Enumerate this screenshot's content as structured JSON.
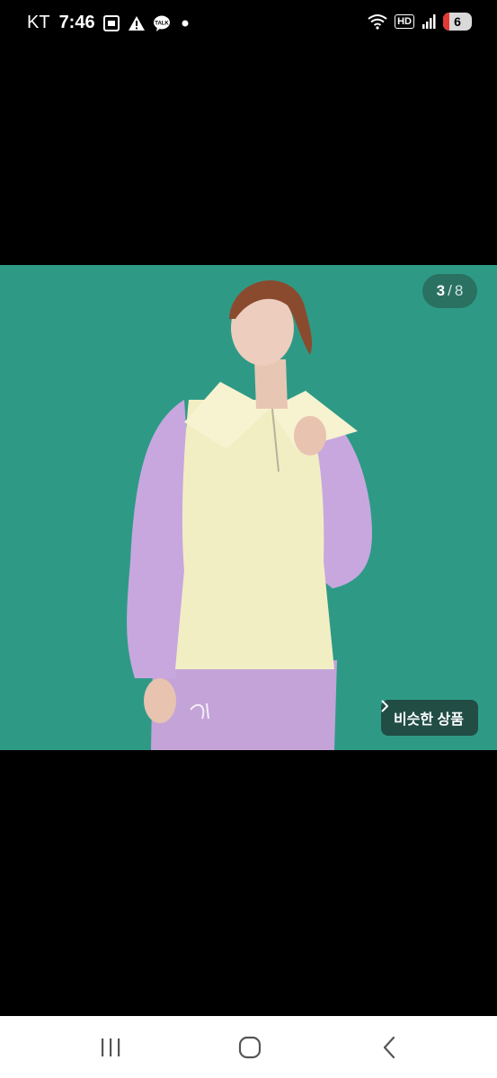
{
  "status_bar": {
    "carrier": "KT",
    "time": "7:46",
    "notification_icons": [
      "screenshot-icon",
      "warning-icon",
      "kakaotalk-icon",
      "dot-icon"
    ],
    "kakao_label": "TALK",
    "hd_label": "HD",
    "battery_level": "6"
  },
  "gallery": {
    "current": "3",
    "separator": "/",
    "total": "8",
    "similar_button_label": "비슷한 상품"
  },
  "nav_bar": {
    "buttons": [
      "recents-icon",
      "home-icon",
      "back-icon"
    ]
  },
  "colors": {
    "background": "#000000",
    "photo_bg": "#2e9a86",
    "sleeve": "#c8a7df",
    "body_cream": "#f2eec4"
  }
}
